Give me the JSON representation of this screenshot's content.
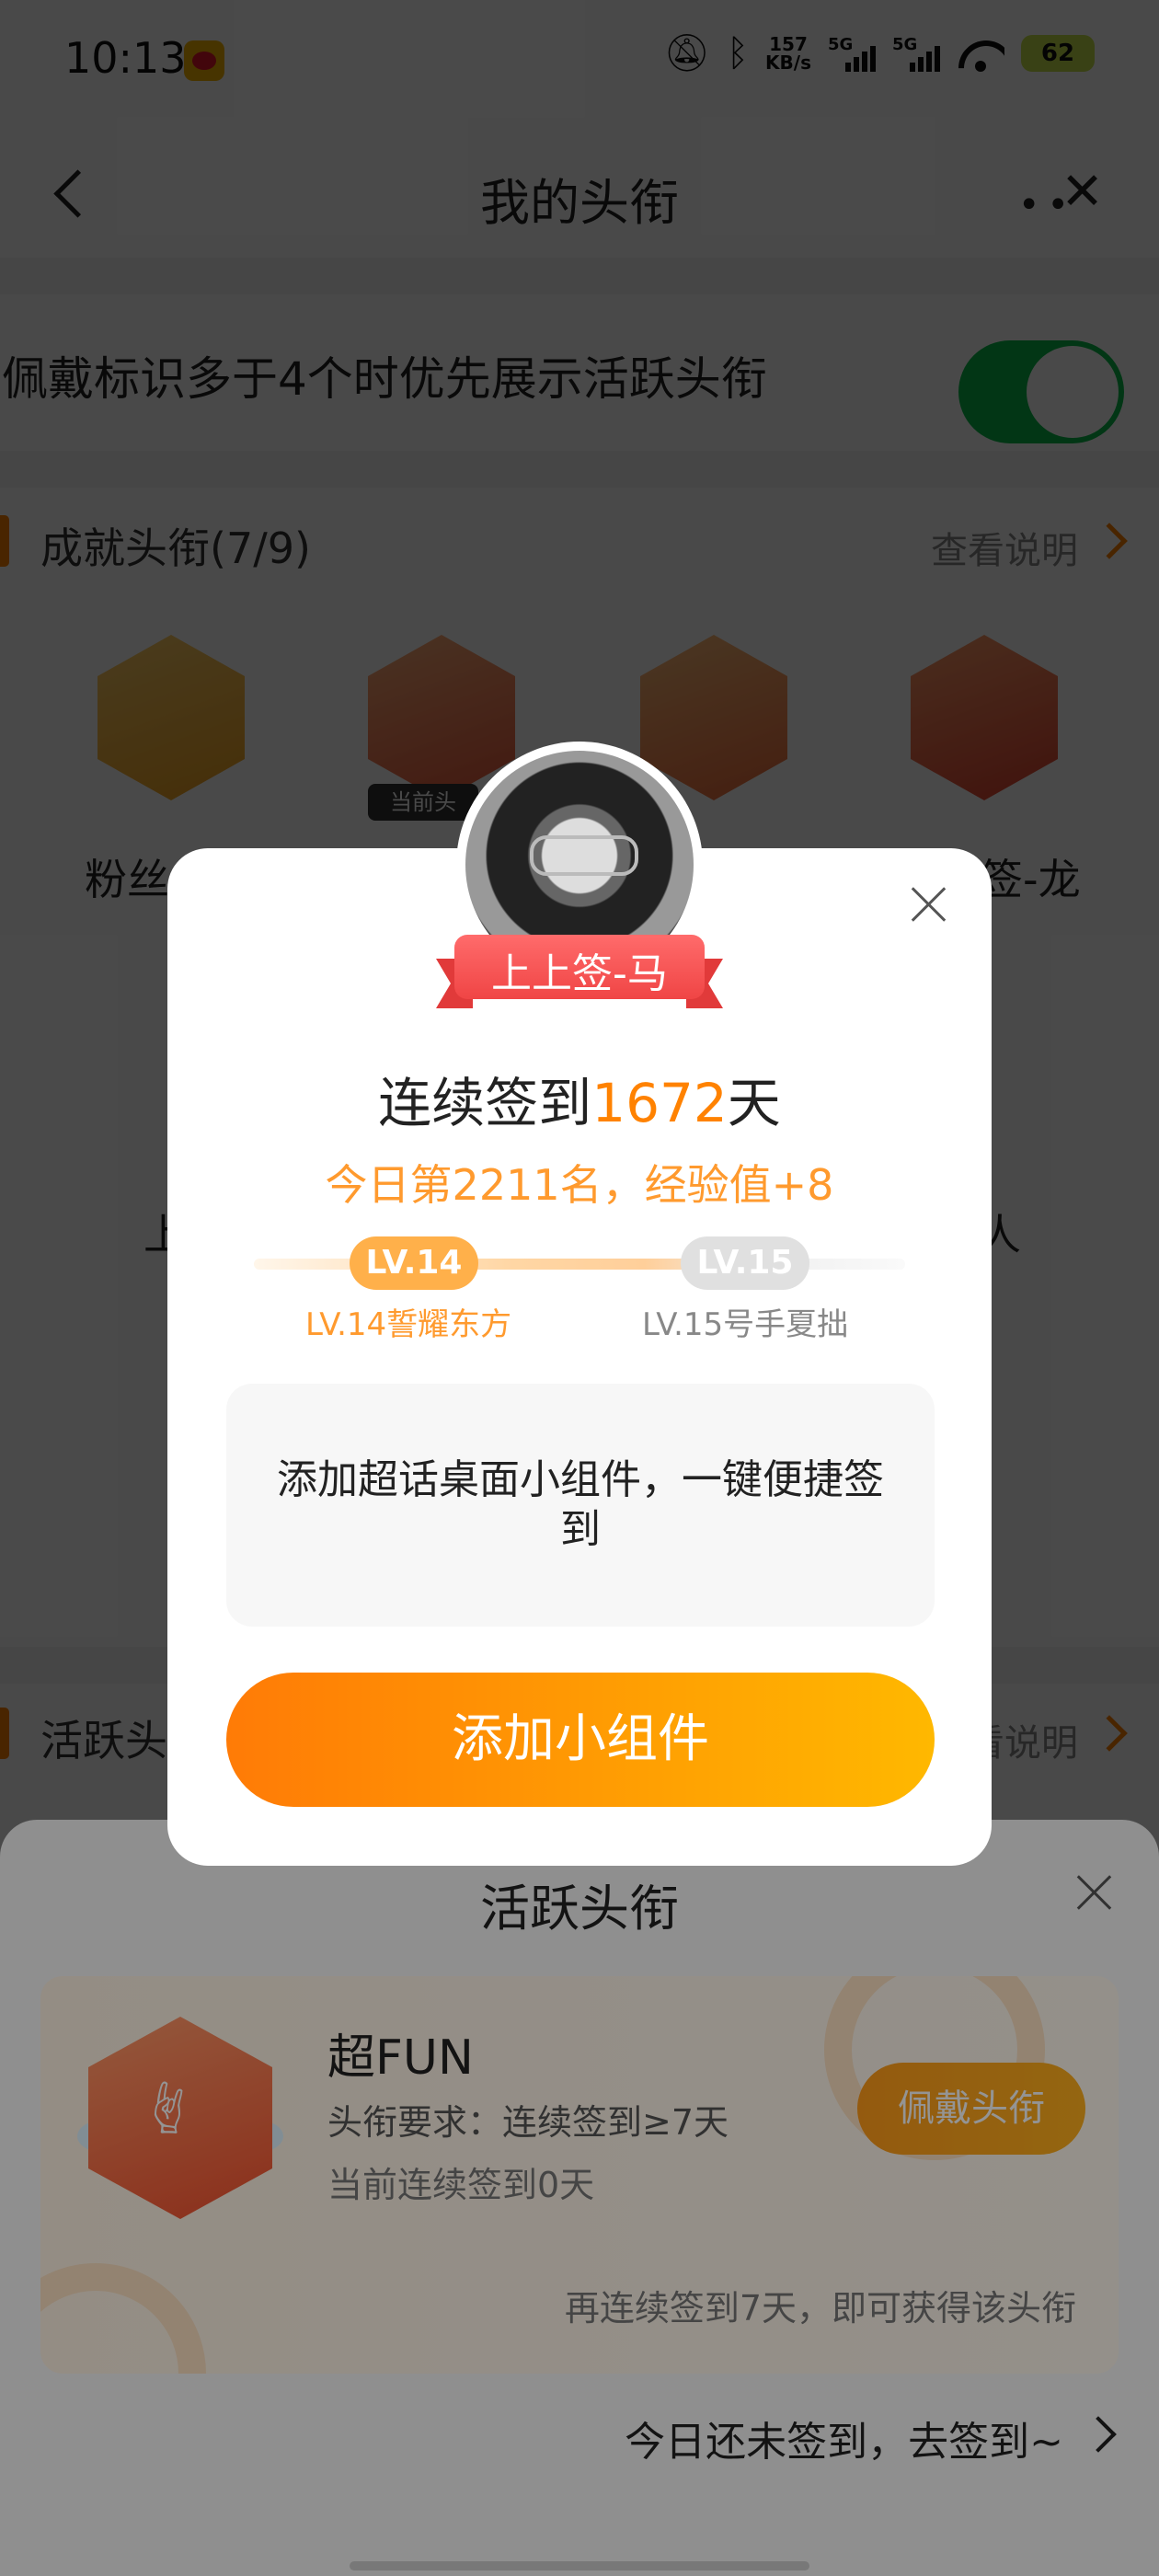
{
  "status_bar": {
    "time": "10:13",
    "net_speed_value": "157",
    "net_speed_unit": "KB/s",
    "signal_1": "5G",
    "signal_2": "5G",
    "battery": "62"
  },
  "nav": {
    "title": "我的头衔",
    "more": "••",
    "close": "✕"
  },
  "preference": {
    "text": "佩戴标识多于4个时优先展示活跃头衔",
    "toggle_on": true
  },
  "achievement_section": {
    "title": "成就头衔(7/9)",
    "link": "查看说明",
    "current_tag": "当前头",
    "labels": [
      "粉丝",
      "签-龙"
    ]
  },
  "active_section": {
    "title": "活跃头",
    "link": "看说明"
  },
  "background_row": {
    "left": "上",
    "right": "人"
  },
  "modal": {
    "ribbon": "上上签-马",
    "streak_prefix": "连续签到",
    "streak_days": "1672",
    "streak_suffix": "天",
    "rank": "今日第2211名，经验值+8",
    "level_current": "LV.14",
    "level_next": "LV.15",
    "level_current_name": "LV.14誓耀东方",
    "level_next_name": "LV.15号手夏拙",
    "widget_promo": "添加超话桌面小组件，一键便捷签到",
    "add_widget_button": "添加小组件"
  },
  "sheet": {
    "title": "活跃头衔",
    "badge_name": "超FUN",
    "requirement": "头衔要求：连续签到≥7天",
    "current": "当前连续签到0天",
    "wear_button": "佩戴头衔",
    "hint": "再连续签到7天，即可获得该头衔",
    "go_sign": "今日还未签到，去签到~"
  },
  "colors": {
    "accent": "#ff8200",
    "toggle": "#0bbd4a",
    "button_start": "#ff7b06",
    "button_end": "#ffb800"
  }
}
